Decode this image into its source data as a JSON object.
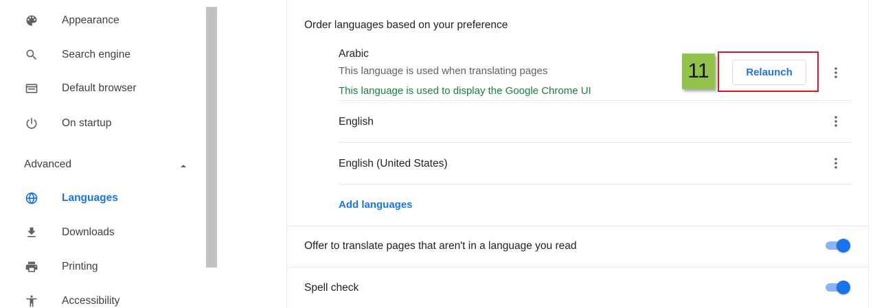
{
  "sidebar": {
    "items": [
      {
        "label": "Appearance",
        "icon": "palette-icon"
      },
      {
        "label": "Search engine",
        "icon": "search-icon"
      },
      {
        "label": "Default browser",
        "icon": "browser-window-icon"
      },
      {
        "label": "On startup",
        "icon": "power-icon"
      }
    ],
    "advanced": {
      "label": "Advanced",
      "expanded": true
    },
    "advanced_items": [
      {
        "label": "Languages",
        "icon": "globe-icon",
        "active": true
      },
      {
        "label": "Downloads",
        "icon": "download-icon"
      },
      {
        "label": "Printing",
        "icon": "printer-icon"
      },
      {
        "label": "Accessibility",
        "icon": "accessibility-icon"
      }
    ]
  },
  "languages": {
    "order_title": "Order languages based on your preference",
    "list": [
      {
        "name": "Arabic",
        "note1": "This language is used when translating pages",
        "note2": "This language is used to display the Google Chrome UI",
        "action": "Relaunch"
      },
      {
        "name": "English"
      },
      {
        "name": "English (United States)"
      }
    ],
    "add_link": "Add languages"
  },
  "settings": {
    "offer_translate": {
      "label": "Offer to translate pages that aren't in a language you read",
      "enabled": true
    },
    "spell_check": {
      "label": "Spell check",
      "enabled": true
    }
  },
  "annotation": {
    "step_number": "11",
    "highlight_color": "#e0141e",
    "badge_color": "#92c24a"
  },
  "colors": {
    "accent": "#1a73e8",
    "success": "#188038",
    "toggle_track": "#8ab4f8"
  }
}
